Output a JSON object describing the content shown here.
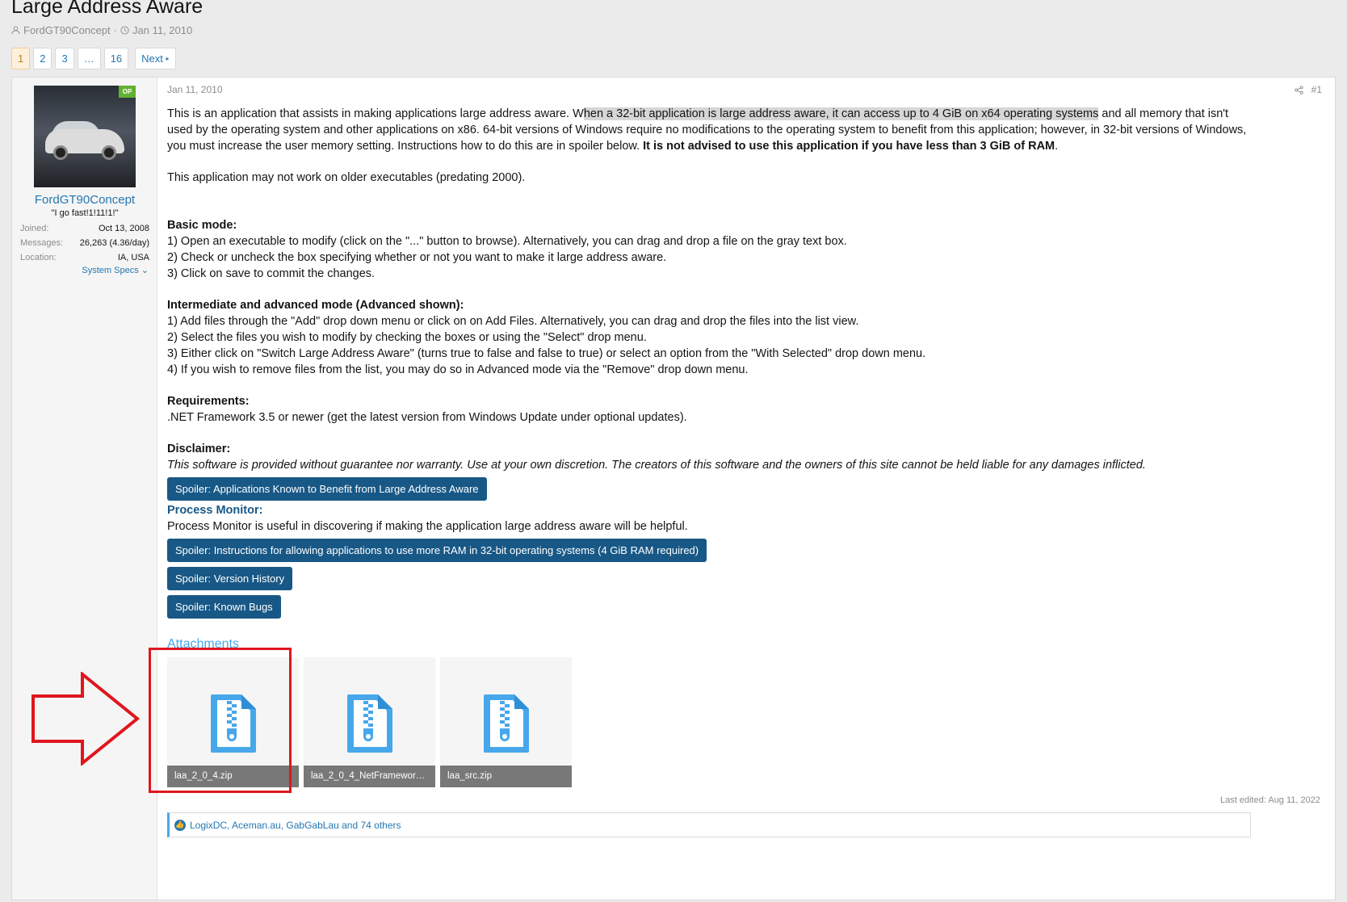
{
  "thread": {
    "title": "Large Address Aware",
    "author": "FordGT90Concept",
    "date": "Jan 11, 2010"
  },
  "pagination": {
    "pages": [
      "1",
      "2",
      "3",
      "…",
      "16"
    ],
    "current": "1",
    "next_label": "Next"
  },
  "user": {
    "name": "FordGT90Concept",
    "badge": "OP",
    "title": "\"I go fast!1!11!1!\"",
    "fields": [
      {
        "label": "Joined:",
        "value": "Oct 13, 2008"
      },
      {
        "label": "Messages:",
        "value": "26,263 (4.36/day)"
      },
      {
        "label": "Location:",
        "value": "IA, USA"
      }
    ],
    "system_specs_label": "System Specs"
  },
  "post": {
    "date": "Jan 11, 2010",
    "number": "#1",
    "intro_a": "This is an application that assists in making applications large address aware. W",
    "intro_hl": "hen a 32-bit application is large address aware, it can access up to 4 GiB on x64 operating systems",
    "intro_b": " and all memory that isn't used by the operating system and other applications on x86. 64-bit versions of Windows require no modifications to the operating system to benefit from this application; however, in 32-bit versions of Windows, you must increase the user memory setting. Instructions how to do this are in spoiler below. ",
    "intro_bold": "It is not advised to use this application if you have less than 3 GiB of RAM",
    "intro_end": ".",
    "older_note": "This application may not work on older executables (predating 2000).",
    "basic_heading": "Basic mode:",
    "basic_steps": [
      "1) Open an executable to modify (click on the \"...\" button to browse). Alternatively, you can drag and drop a file on the gray text box.",
      "2) Check or uncheck the box specifying whether or not you want to make it large address aware.",
      "3) Click on save to commit the changes."
    ],
    "adv_heading": "Intermediate and advanced mode (Advanced shown):",
    "adv_steps": [
      "1) Add files through the \"Add\" drop down menu or click on on Add Files. Alternatively, you can drag and drop the files into the list view.",
      "2) Select the files you wish to modify by checking the boxes or using the \"Select\" drop menu.",
      "3) Either click on \"Switch Large Address Aware\" (turns true to false and false to true) or select an option from the \"With Selected\" drop down menu.",
      "4) If you wish to remove files from the list, you may do so in Advanced mode via the \"Remove\" drop down menu."
    ],
    "req_heading": "Requirements:",
    "req_text": ".NET Framework 3.5 or newer (get the latest version from Windows Update under optional updates).",
    "disc_heading": "Disclaimer:",
    "disc_text": "This software is provided without guarantee nor warranty. Use at your own discretion. The creators of this software and the owners of this site cannot be held liable for any damages inflicted.",
    "spoiler_1": "Spoiler: Applications Known to Benefit from Large Address Aware",
    "pm_heading": "Process Monitor:",
    "pm_text": "Process Monitor is useful in discovering if making the application large address aware will be helpful.",
    "spoiler_2": "Spoiler: Instructions for allowing applications to use more RAM in 32-bit operating systems (4 GiB RAM required)",
    "spoiler_3": "Spoiler: Version History",
    "spoiler_4": "Spoiler: Known Bugs",
    "attachments_title": "Attachments",
    "attachments": [
      "laa_2_0_4.zip",
      "laa_2_0_4_NetFramework...",
      "laa_src.zip"
    ],
    "last_edited": "Last edited: Aug 11, 2022",
    "likes_text": "LogixDC, Aceman.au, GabGabLau and 74 others"
  },
  "colors": {
    "link": "#2577b1",
    "spoiler_bg": "#185886",
    "annotation_red": "#e0161d",
    "zip_icon": "#47a7eb"
  }
}
